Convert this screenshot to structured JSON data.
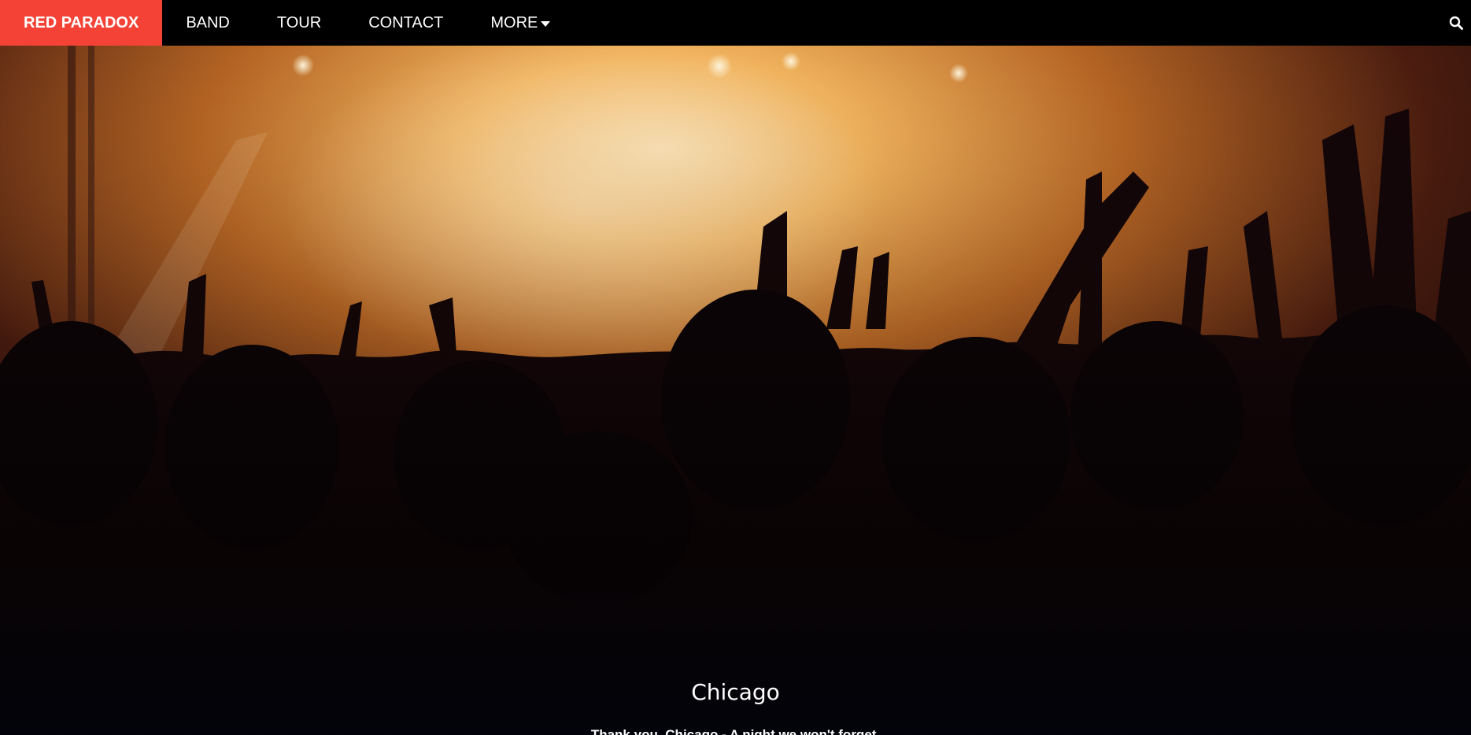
{
  "nav": {
    "brand": "RED PARADOX",
    "items": [
      "BAND",
      "TOUR",
      "CONTACT"
    ],
    "more_label": "MORE",
    "search_icon": "search-icon",
    "colors": {
      "bar": "#000000",
      "brand_bg": "#f44336",
      "text": "#ffffff"
    }
  },
  "hero": {
    "title": "Chicago",
    "subtitle": "Thank you, Chicago - A night we won't forget."
  }
}
